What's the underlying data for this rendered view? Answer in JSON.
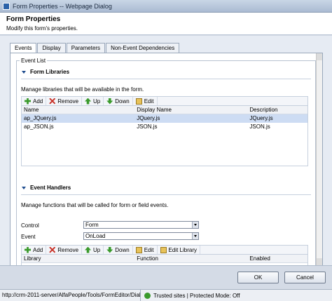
{
  "window": {
    "title": "Form Properties -- Webpage Dialog"
  },
  "header": {
    "title": "Form Properties",
    "subtitle": "Modify this form's properties."
  },
  "tabs": [
    {
      "label": "Events"
    },
    {
      "label": "Display"
    },
    {
      "label": "Parameters"
    },
    {
      "label": "Non-Event Dependencies"
    }
  ],
  "event_list": {
    "legend": "Event List",
    "libraries": {
      "title": "Form Libraries",
      "description": "Manage libraries that will be available in the form.",
      "toolbar": {
        "add": "Add",
        "remove": "Remove",
        "up": "Up",
        "down": "Down",
        "edit": "Edit"
      },
      "columns": [
        "Name",
        "Display Name",
        "Description"
      ],
      "rows": [
        {
          "name": "ap_JQuery.js",
          "display": "JQuery.js",
          "description": "JQuery.js"
        },
        {
          "name": "ap_JSON.js",
          "display": "JSON.js",
          "description": "JSON.js"
        }
      ]
    },
    "handlers": {
      "title": "Event Handlers",
      "description": "Manage functions that will be called for form or field events.",
      "control_label": "Control",
      "control_value": "Form",
      "event_label": "Event",
      "event_value": "OnLoad",
      "toolbar": {
        "add": "Add",
        "remove": "Remove",
        "up": "Up",
        "down": "Down",
        "edit": "Edit",
        "edit_library": "Edit Library"
      },
      "columns": [
        "Library",
        "Function",
        "Enabled"
      ]
    }
  },
  "footer": {
    "ok": "OK",
    "cancel": "Cancel"
  },
  "status": {
    "url": "http://crm-2011-server/AlfaPeople/Tools/FormEditor/Dial",
    "zone": "Trusted sites | Protected Mode: Off"
  }
}
